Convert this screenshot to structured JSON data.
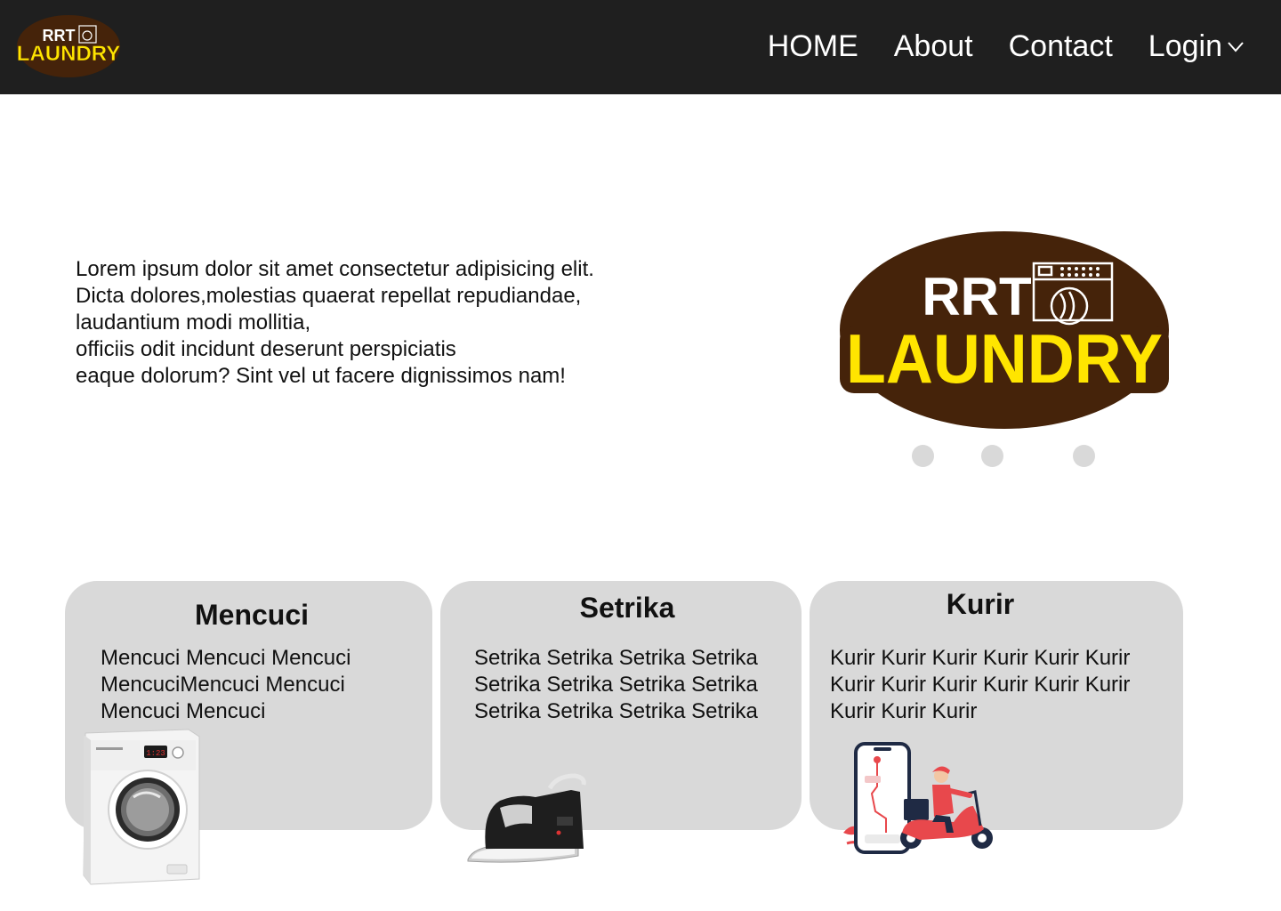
{
  "brand": {
    "logo_top": "RRT",
    "logo_bottom": "LAUNDRY"
  },
  "nav": {
    "home": "HOME",
    "about": "About",
    "contact": "Contact",
    "login": "Login"
  },
  "hero": {
    "lines": [
      "Lorem ipsum dolor sit amet consectetur adipisicing elit.",
      "Dicta dolores,molestias quaerat repellat repudiandae,",
      "laudantium modi mollitia,",
      "officiis odit incidunt deserunt perspiciatis",
      "eaque dolorum? Sint vel ut facere dignissimos nam!"
    ],
    "slide_count": 3
  },
  "services": [
    {
      "title": "Mencuci",
      "lines": [
        "Mencuci Mencuci Mencuci",
        "MencuciMencuci Mencuci",
        "Mencuci Mencuci"
      ],
      "illustration": "washing-machine"
    },
    {
      "title": "Setrika",
      "lines": [
        "Setrika Setrika Setrika Setrika",
        "Setrika Setrika Setrika Setrika",
        "Setrika Setrika Setrika Setrika"
      ],
      "illustration": "iron"
    },
    {
      "title": "Kurir",
      "lines": [
        "Kurir Kurir Kurir Kurir Kurir Kurir",
        "Kurir Kurir Kurir Kurir Kurir Kurir",
        "Kurir Kurir Kurir"
      ],
      "illustration": "courier-scooter"
    }
  ],
  "colors": {
    "navbar_bg": "#1f1f1f",
    "logo_brown": "#45230a",
    "logo_yellow": "#ffe500",
    "card_bg": "#d9d9d9",
    "dot": "#d9d9d9",
    "courier_red": "#e8484c"
  }
}
